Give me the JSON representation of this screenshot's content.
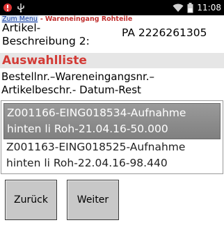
{
  "statusbar": {
    "time": "11:08",
    "icons": [
      "notification-icon",
      "usb-icon",
      "wifi-icon",
      "battery-icon"
    ]
  },
  "header": {
    "menu_link": "Zum Menu",
    "separator": "-",
    "title": "Wareneingang Rohteile"
  },
  "article": {
    "label_line1": "Artikel-",
    "label_line2": "Beschreibung 2:",
    "value": "PA 2226261305"
  },
  "section": {
    "title": "Auswahlliste"
  },
  "columns": {
    "line1": "Bestellnr.–Wareneingangsnr.–",
    "line2": "Artikelbeschr.- Datum-Rest"
  },
  "list": {
    "items": [
      {
        "line1": "Z001166-EING018534-Aufnahme",
        "line2": "hinten li Roh-21.04.16-50.000",
        "selected": true
      },
      {
        "line1": "Z001163-EING018525-Aufnahme",
        "line2": "hinten li Roh-22.04.16-98.440",
        "selected": false
      }
    ]
  },
  "buttons": {
    "back": "Zurück",
    "next": "Weiter"
  },
  "colors": {
    "title_red": "#d33b36",
    "menu_link_blue": "#1a3ea0",
    "selected_item_bg": "#8c8c8c"
  }
}
